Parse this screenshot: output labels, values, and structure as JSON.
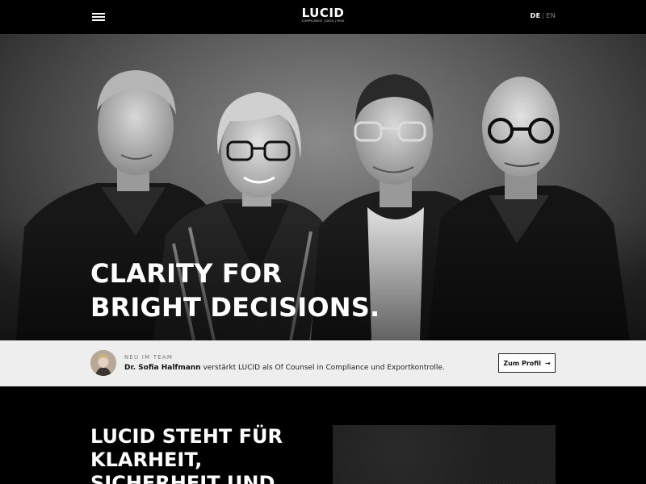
{
  "header": {
    "logo_text": "LUCID",
    "logo_tagline": "COMPLIANCE | DATA | RISK",
    "lang_active": "DE",
    "lang_separator": "|",
    "lang_inactive": "EN"
  },
  "hero": {
    "title_line1": "CLARITY FOR",
    "title_line2": "BRIGHT DECISIONS."
  },
  "news": {
    "label": "NEU IM TEAM",
    "name": "Dr. Sofia Halfmann",
    "text": " verstärkt LUCID als Of Counsel in Compliance und Exportkontrolle.",
    "button_label": "Zum Profil",
    "button_icon": "arrow-right-icon",
    "button_arrow": "→"
  },
  "lower": {
    "title_line1": "LUCID STEHT FÜR",
    "title_line2": "KLARHEIT,",
    "title_line3": "SICHERHEIT UND"
  },
  "colors": {
    "background": "#000000",
    "news_bar": "#eeeeee",
    "text_light": "#ffffff"
  }
}
